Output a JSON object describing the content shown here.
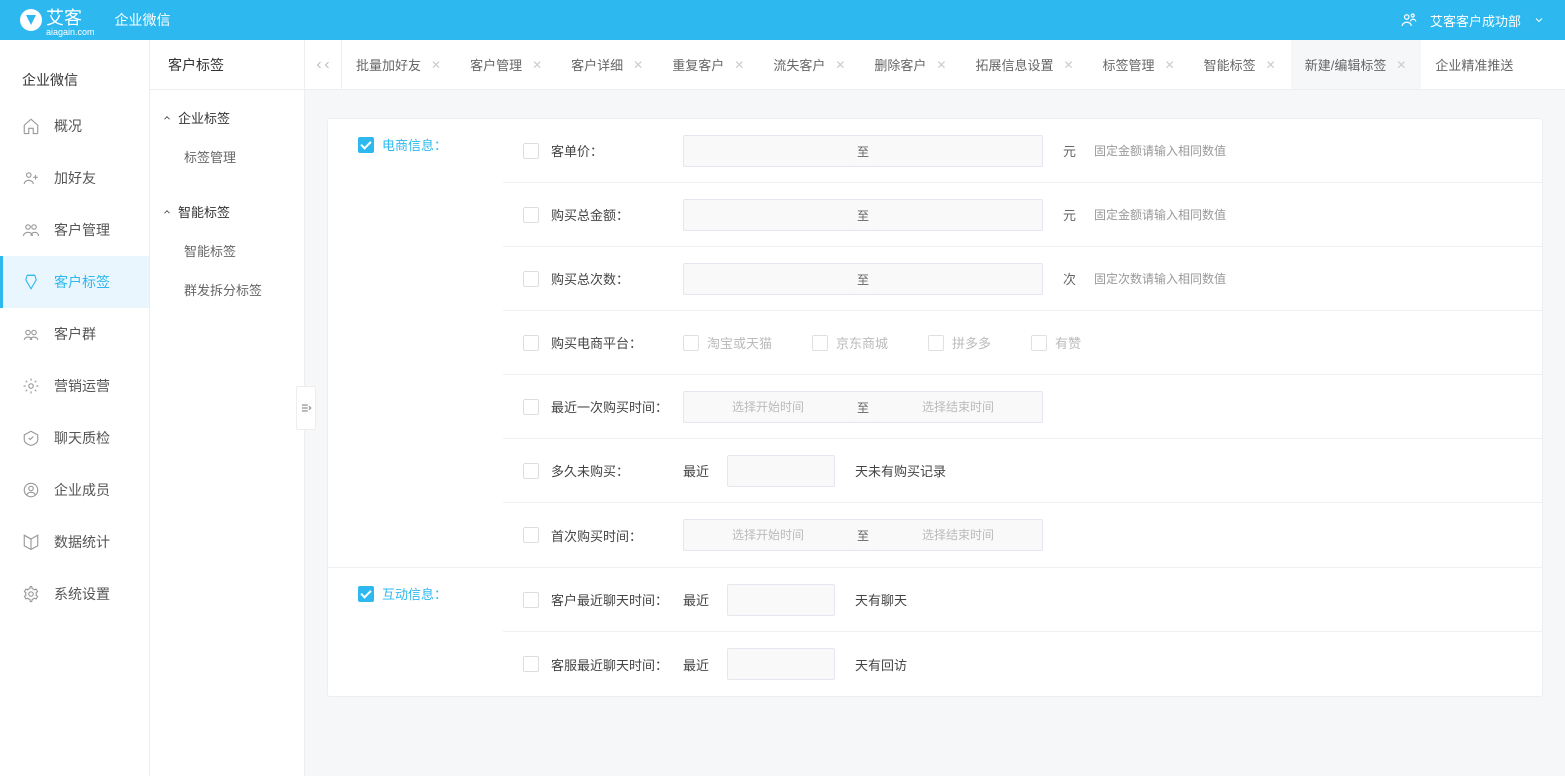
{
  "header": {
    "brand": "艾客",
    "brand_sub": "aiagain.com",
    "product": "企业微信",
    "department": "艾客客户成功部"
  },
  "sidebar1": {
    "title": "企业微信",
    "items": [
      {
        "id": "overview",
        "label": "概况"
      },
      {
        "id": "add-friend",
        "label": "加好友"
      },
      {
        "id": "customer-mgmt",
        "label": "客户管理"
      },
      {
        "id": "customer-tag",
        "label": "客户标签"
      },
      {
        "id": "customer-group",
        "label": "客户群"
      },
      {
        "id": "marketing",
        "label": "营销运营"
      },
      {
        "id": "chat-qc",
        "label": "聊天质检"
      },
      {
        "id": "members",
        "label": "企业成员"
      },
      {
        "id": "data-stats",
        "label": "数据统计"
      },
      {
        "id": "settings",
        "label": "系统设置"
      }
    ]
  },
  "sidebar2": {
    "title": "客户标签",
    "groups": [
      {
        "header": "企业标签",
        "items": [
          "标签管理"
        ]
      },
      {
        "header": "智能标签",
        "items": [
          "智能标签",
          "群发拆分标签"
        ]
      }
    ]
  },
  "tabs": [
    {
      "label": "批量加好友",
      "closable": true
    },
    {
      "label": "客户管理",
      "closable": true
    },
    {
      "label": "客户详细",
      "closable": true
    },
    {
      "label": "重复客户",
      "closable": true
    },
    {
      "label": "流失客户",
      "closable": true
    },
    {
      "label": "删除客户",
      "closable": true
    },
    {
      "label": "拓展信息设置",
      "closable": true
    },
    {
      "label": "标签管理",
      "closable": true
    },
    {
      "label": "智能标签",
      "closable": true
    },
    {
      "label": "新建/编辑标签",
      "closable": true,
      "active": true
    },
    {
      "label": "企业精准推送",
      "closable": false
    }
  ],
  "form": {
    "sections": [
      {
        "title": "电商信息：",
        "checked": true,
        "rows": [
          {
            "key": "unit-price",
            "label": "客单价：",
            "type": "range",
            "unit": "元",
            "hint": "固定金额请输入相同数值",
            "sep": "至"
          },
          {
            "key": "total-amount",
            "label": "购买总金额：",
            "type": "range",
            "unit": "元",
            "hint": "固定金额请输入相同数值",
            "sep": "至"
          },
          {
            "key": "total-count",
            "label": "购买总次数：",
            "type": "range",
            "unit": "次",
            "hint": "固定次数请输入相同数值",
            "sep": "至"
          },
          {
            "key": "platform",
            "label": "购买电商平台：",
            "type": "checkboxes",
            "options": [
              "淘宝或天猫",
              "京东商城",
              "拼多多",
              "有赞"
            ]
          },
          {
            "key": "last-purchase",
            "label": "最近一次购买时间：",
            "type": "daterange",
            "start_ph": "选择开始时间",
            "end_ph": "选择结束时间",
            "sep": "至"
          },
          {
            "key": "no-purchase",
            "label": "多久未购买：",
            "type": "recent",
            "prefix": "最近",
            "suffix": "天未有购买记录"
          },
          {
            "key": "first-purchase",
            "label": "首次购买时间：",
            "type": "daterange",
            "start_ph": "选择开始时间",
            "end_ph": "选择结束时间",
            "sep": "至"
          }
        ]
      },
      {
        "title": "互动信息：",
        "checked": true,
        "rows": [
          {
            "key": "customer-chat",
            "label": "客户最近聊天时间：",
            "type": "recent",
            "prefix": "最近",
            "suffix": "天有聊天"
          },
          {
            "key": "service-chat",
            "label": "客服最近聊天时间：",
            "type": "recent",
            "prefix": "最近",
            "suffix": "天有回访"
          }
        ]
      }
    ]
  }
}
